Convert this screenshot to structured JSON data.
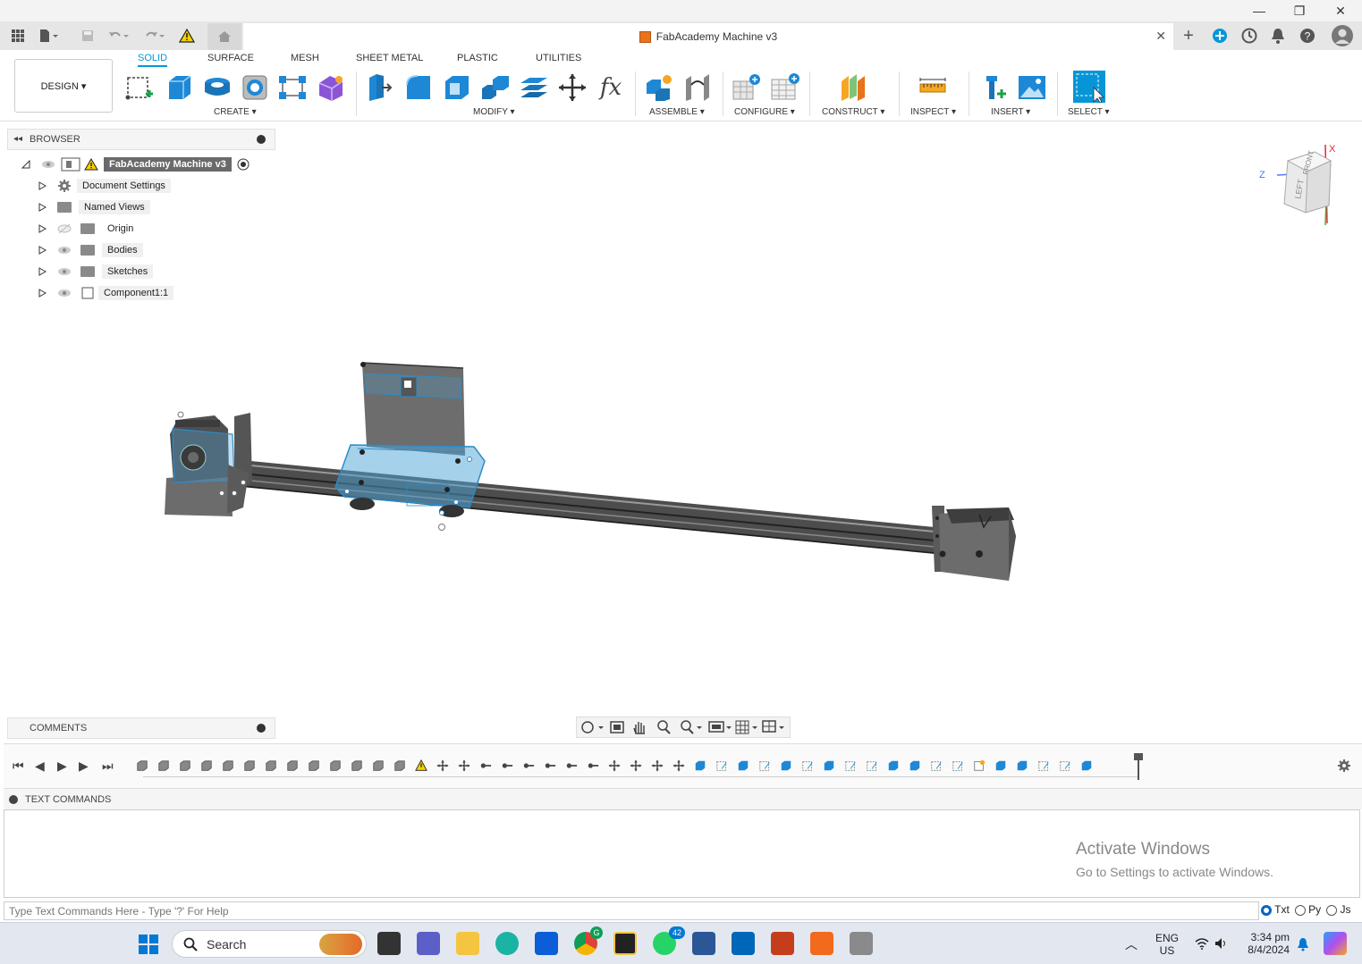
{
  "window": {
    "minimize_glyph": "—",
    "maximize_glyph": "❐",
    "close_glyph": "✕"
  },
  "appbar": {
    "doc_title": "FabAcademy Machine v3",
    "close_tab_glyph": "✕",
    "new_tab_glyph": "+"
  },
  "ribbon": {
    "workspace": "DESIGN ▾",
    "tabs": [
      "SOLID",
      "SURFACE",
      "MESH",
      "SHEET METAL",
      "PLASTIC",
      "UTILITIES"
    ],
    "groups": {
      "create": "CREATE ▾",
      "modify": "MODIFY ▾",
      "assemble": "ASSEMBLE ▾",
      "configure": "CONFIGURE ▾",
      "construct": "CONSTRUCT ▾",
      "inspect": "INSPECT ▾",
      "insert": "INSERT ▾",
      "select": "SELECT ▾"
    },
    "fx_glyph": "fx"
  },
  "browser": {
    "title": "BROWSER",
    "root": "FabAcademy Machine v3",
    "items": [
      {
        "label": "Document Settings"
      },
      {
        "label": "Named Views"
      },
      {
        "label": "Origin"
      },
      {
        "label": "Bodies"
      },
      {
        "label": "Sketches"
      },
      {
        "label": "Component1:1"
      }
    ]
  },
  "viewcube": {
    "front": "FRONT",
    "left": "LEFT",
    "axis_z": "Z",
    "axis_x": "X"
  },
  "comments": {
    "title": "COMMENTS"
  },
  "text_commands": {
    "title": "TEXT COMMANDS",
    "placeholder": "Type Text Commands Here - Type '?' For Help",
    "modes": [
      "Txt",
      "Py",
      "Js"
    ],
    "selected_mode": "Txt"
  },
  "watermark": {
    "line1": "Activate Windows",
    "line2": "Go to Settings to activate Windows."
  },
  "taskbar": {
    "search": "Search",
    "lang1": "ENG",
    "lang2": "US",
    "time": "3:34 pm",
    "date": "8/4/2024",
    "whatsapp_badge": "42",
    "chrome_badge": "G"
  },
  "colors": {
    "accent": "#0696d7",
    "model": "#5f5f5f",
    "selection": "#4ea3d8"
  }
}
